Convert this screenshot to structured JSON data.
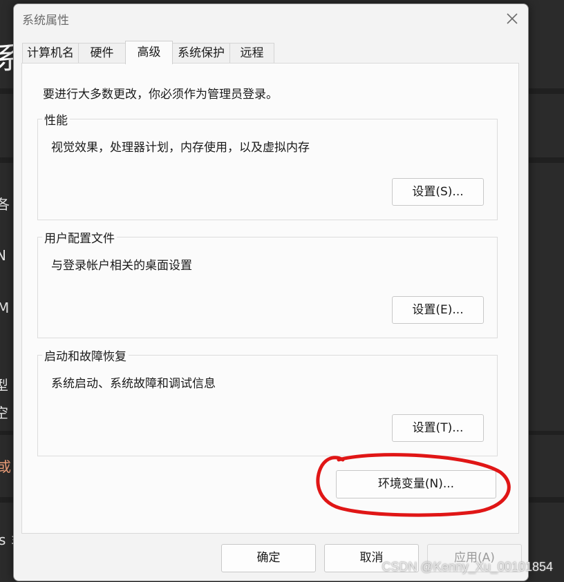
{
  "background_window": {
    "title_fragment": "系",
    "side_fragments": [
      "各",
      "Ɲ",
      "M",
      "型",
      "空",
      "或",
      "s 丯"
    ]
  },
  "dialog": {
    "title": "系统属性",
    "close_label": "✕",
    "tabs": [
      {
        "label": "计算机名"
      },
      {
        "label": "硬件"
      },
      {
        "label": "高级"
      },
      {
        "label": "系统保护"
      },
      {
        "label": "远程"
      }
    ],
    "active_tab": "高级",
    "admin_note": "要进行大多数更改，你必须作为管理员登录。",
    "groups": [
      {
        "title": "性能",
        "description": "视觉效果，处理器计划，内存使用，以及虚拟内存",
        "button": "设置(S)..."
      },
      {
        "title": "用户配置文件",
        "description": "与登录帐户相关的桌面设置",
        "button": "设置(E)..."
      },
      {
        "title": "启动和故障恢复",
        "description": "系统启动、系统故障和调试信息",
        "button": "设置(T)..."
      }
    ],
    "env_button": "环境变量(N)...",
    "ok_button": "确定",
    "cancel_button": "取消",
    "apply_button": "应用(A)"
  },
  "watermark": "CSDN @Kenny_Xu_00101854",
  "colors": {
    "annotation_red": "#e01616",
    "dialog_bg": "#f3f3f3",
    "panel_bg": "#fbfbfb",
    "backdrop": "#202020"
  }
}
